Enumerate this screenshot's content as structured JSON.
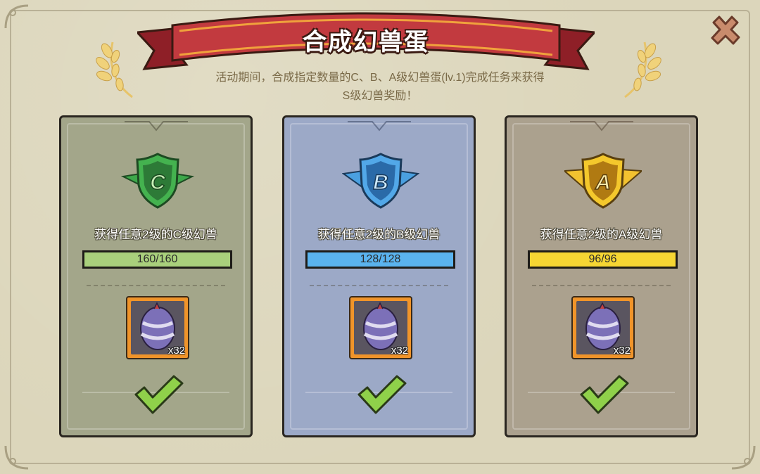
{
  "title": "合成幻兽蛋",
  "description": {
    "line1": "活动期间，合成指定数量的C、B、A级幻兽蛋(lv.1)完成任务来获得",
    "line2": "S级幻兽奖励！"
  },
  "close_icon": "close-icon",
  "colors": {
    "ribbon": "#b8323a",
    "card_c": "#a3a68a",
    "card_b": "#9ca9c7",
    "card_a": "#aba18e",
    "bar_c": "#a9d07c",
    "bar_b": "#5ab3ee",
    "bar_a": "#f6d633",
    "check": "#8fd14a"
  },
  "cards": [
    {
      "grade": "C",
      "task": "获得任意2级的C级幻兽",
      "progress_text": "160/160",
      "progress": 1.0,
      "reward_qty": "x32",
      "reward_icon": "egg-icon",
      "status_icon": "check-icon"
    },
    {
      "grade": "B",
      "task": "获得任意2级的B级幻兽",
      "progress_text": "128/128",
      "progress": 1.0,
      "reward_qty": "x32",
      "reward_icon": "egg-icon",
      "status_icon": "check-icon"
    },
    {
      "grade": "A",
      "task": "获得任意2级的A级幻兽",
      "progress_text": "96/96",
      "progress": 1.0,
      "reward_qty": "x32",
      "reward_icon": "egg-icon",
      "status_icon": "check-icon"
    }
  ]
}
